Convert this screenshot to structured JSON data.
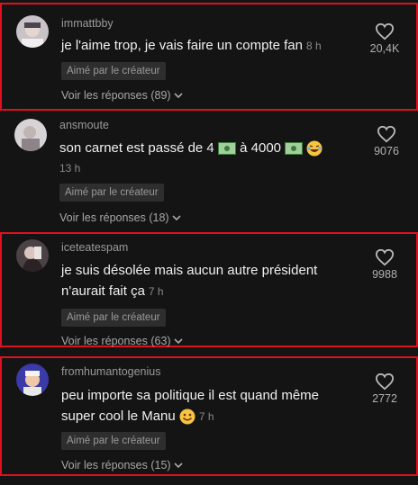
{
  "comments": [
    {
      "username": "immattbby",
      "text": "je l'aime trop, je vais faire un compte fan",
      "time": "8 h",
      "liked_badge": "Aimé par le créateur",
      "replies": "Voir les réponses (89)",
      "likes": "20,4K"
    },
    {
      "username": "ansmoute",
      "text_before": "son carnet est passé de 4",
      "text_mid": "à 4000",
      "time": "13 h",
      "liked_badge": "Aimé par le créateur",
      "replies": "Voir les réponses (18)",
      "likes": "9076"
    },
    {
      "username": "iceteatespam",
      "text": "je suis désolée mais aucun autre président n'aurait fait ça",
      "time": "7 h",
      "liked_badge": "Aimé par le créateur",
      "replies": "Voir les réponses (63)",
      "likes": "9988"
    },
    {
      "username": "fromhumantogenius",
      "text": "peu importe sa politique il est quand même super cool le Manu",
      "time": "7 h",
      "liked_badge": "Aimé par le créateur",
      "replies": "Voir les réponses (15)",
      "likes": "2772"
    }
  ],
  "colors": {
    "highlight_border": "#e01020",
    "background": "#141414"
  },
  "icons": [
    "heart-outline-icon",
    "chevron-down-icon",
    "money-emoji-icon",
    "laughing-emoji-icon",
    "grin-emoji-icon"
  ]
}
